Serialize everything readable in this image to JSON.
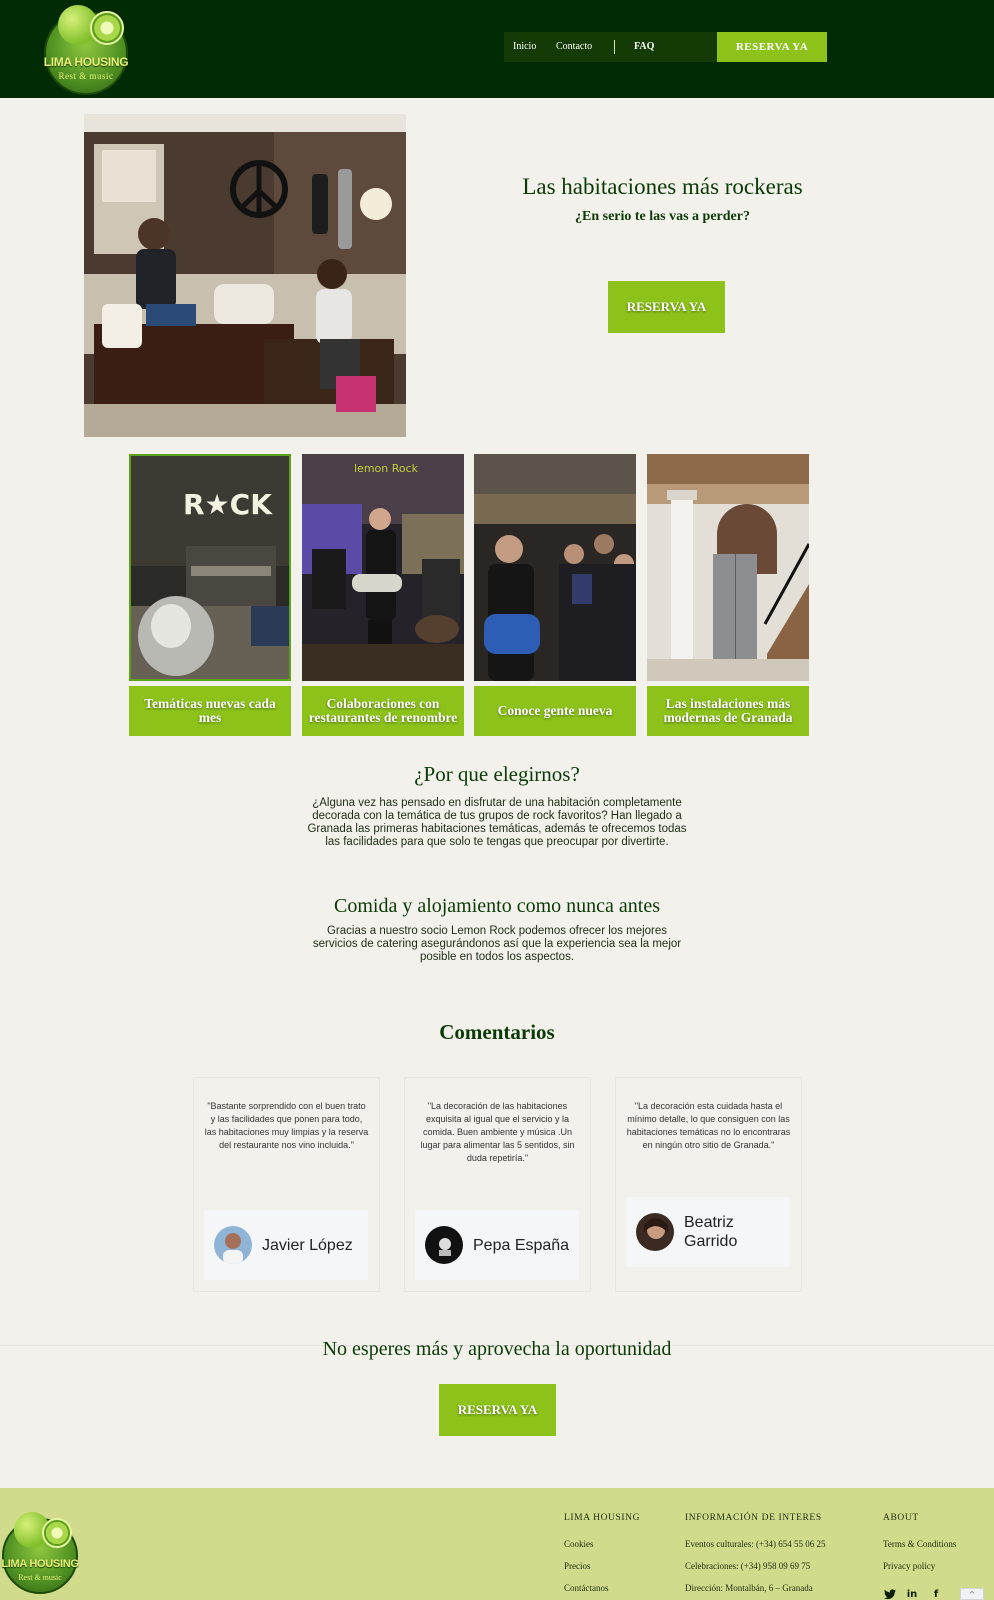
{
  "header": {
    "logo_name": "LIMA HOUSING",
    "logo_tagline": "Rest & music",
    "nav": {
      "inicio": "Inicio",
      "contacto": "Contacto",
      "faq": "FAQ",
      "cta": "RESERVA YA"
    }
  },
  "hero": {
    "title": "Las habitaciones más rockeras",
    "subtitle": "¿En serio te las vas a perder?",
    "button": "RESERVA YA"
  },
  "features": [
    {
      "label": "Temáticas nuevas cada mes"
    },
    {
      "label": "Colaboraciones con restaurantes de renombre"
    },
    {
      "label": "Conoce gente nueva"
    },
    {
      "label": "Las instalaciones más modernas de Granada"
    }
  ],
  "feature_sign": "R★CK",
  "feature_neon": "lemon Rock",
  "why": {
    "title": "¿Por que elegirnos?",
    "text": "¿Alguna vez has pensado en disfrutar de una habitación completamente decorada con la temática de tus grupos de rock favoritos? Han llegado a Granada las primeras habitaciones temáticas, además te ofrecemos todas las facilidades para que solo te tengas que preocupar por divertirte."
  },
  "food": {
    "title": "Comida y alojamiento como nunca antes",
    "text": "Gracias a nuestro socio Lemon Rock podemos ofrecer los mejores servicios de catering asegurándonos así que la experiencia sea la mejor posible en todos los aspectos."
  },
  "reviews": {
    "title": "Comentarios",
    "items": [
      {
        "quote": "\"Bastante sorprendido con el buen trato y las facilidades que ponen para todo, las habitaciones muy limpias y la reserva del restaurante nos vino incluida.\"",
        "author": "Javier López"
      },
      {
        "quote": "\"La decoración de las habitaciones exquisita al igual que el servicio y la comida. Buen ambiente y música .Un lugar para alimentar las 5 sentidos, sin duda repetiría.\"",
        "author": "Pepa España"
      },
      {
        "quote": "\"La decoración esta cuidada hasta el mínimo detalle, lo que consiguen con las habitaciones temáticas no lo encontraras en ningún otro sitio de Granada.\"",
        "author": "Beatriz Garrido"
      }
    ]
  },
  "cta": {
    "title": "No esperes más y aprovecha la oportunidad",
    "button": "RESERVA YA"
  },
  "footer": {
    "col1": {
      "title": "LIMA HOUSING",
      "links": [
        "Cookies",
        "Precios",
        "Contáctanos"
      ]
    },
    "col2": {
      "title": "INFORMACIÓN DE INTERES",
      "links": [
        "Eventos culturales: (+34) 654 55 06 25",
        "Celebraciones: (+34) 958 09 69 75",
        "Dirección: Montalbán, 6 – Granada"
      ]
    },
    "col3": {
      "title": "ABOUT",
      "links": [
        "Terms & Conditions",
        "Privacy policy"
      ]
    },
    "social": [
      "twitter-icon",
      "linkedin-icon",
      "facebook-icon"
    ]
  },
  "colors": {
    "header_bg": "#012b04",
    "accent_green": "#8cc21a",
    "page_bg": "#f2f1ec",
    "footer_bg": "#d0db8c",
    "title_green": "#0c3a06"
  }
}
